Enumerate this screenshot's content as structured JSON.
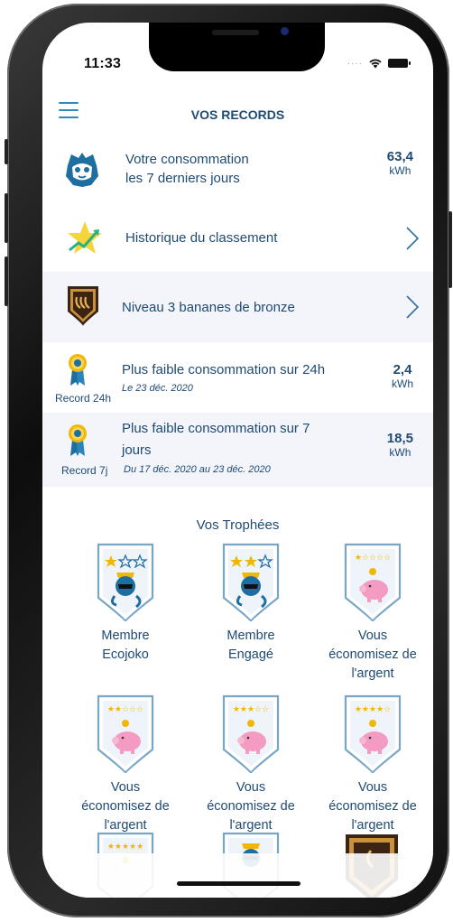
{
  "status_bar": {
    "time": "11:33"
  },
  "header": {
    "title": "VOS RECORDS"
  },
  "consumption": {
    "line1": "Votre consommation",
    "line2": "les 7 derniers jours",
    "value": "63,4",
    "unit": "kWh"
  },
  "ranking": {
    "label": "Historique du classement"
  },
  "level": {
    "label": "Niveau 3 bananes de bronze"
  },
  "record_24h": {
    "badge": "Record 24h",
    "title": "Plus faible consommation sur 24h",
    "date": "Le 23 déc. 2020",
    "value": "2,4",
    "unit": "kWh"
  },
  "record_7j": {
    "badge": "Record 7j",
    "title_line1": "Plus faible consommation sur 7",
    "title_line2": "jours",
    "date": "Du 17 déc. 2020 au 23 déc. 2020",
    "value": "18,5",
    "unit": "kWh"
  },
  "trophies": {
    "title": "Vos Trophées",
    "items": [
      {
        "lines": [
          "Membre",
          "Ecojoko"
        ],
        "icon": "monkey-shield-1-star"
      },
      {
        "lines": [
          "Membre",
          "Engagé"
        ],
        "icon": "monkey-shield-2-star"
      },
      {
        "lines": [
          "Vous",
          "économisez de",
          "l'argent"
        ],
        "icon": "piggy-bank-shield-1-star"
      },
      {
        "lines": [
          "Vous",
          "économisez de",
          "l'argent"
        ],
        "icon": "piggy-bank-shield-2-star"
      },
      {
        "lines": [
          "Vous",
          "économisez de",
          "l'argent"
        ],
        "icon": "piggy-bank-shield-3-star"
      },
      {
        "lines": [
          "Vous",
          "économisez de",
          "l'argent"
        ],
        "icon": "piggy-bank-shield-4-star"
      }
    ]
  },
  "colors": {
    "primary_text": "#1f4a72",
    "accent": "#2e8bb8",
    "row_bg": "#f3f5fb",
    "star": "#f2b705"
  }
}
